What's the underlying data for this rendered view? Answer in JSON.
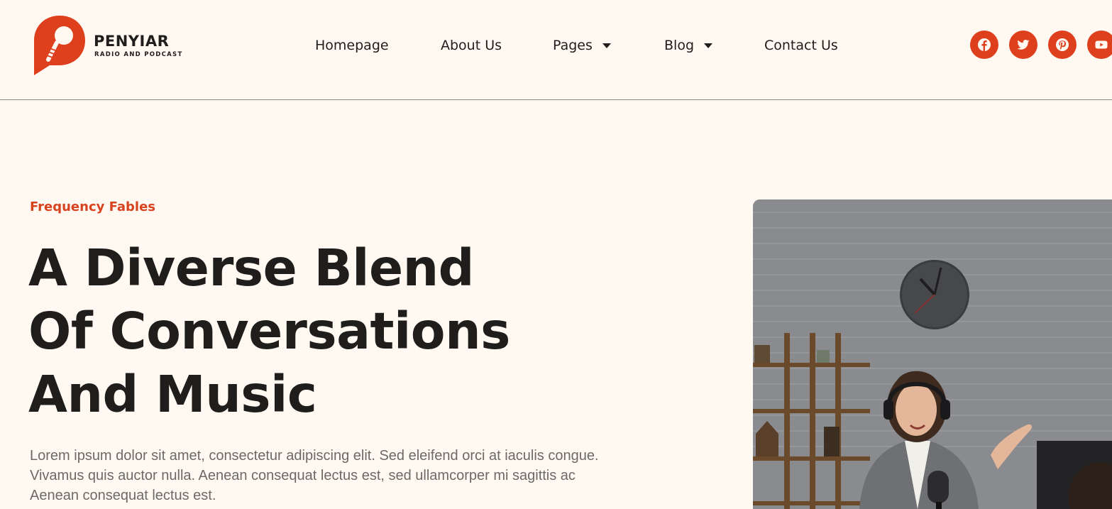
{
  "brand": {
    "name": "PENYIAR",
    "tagline": "RADIO AND PODCAST",
    "accent_color": "#de3f1c"
  },
  "nav": {
    "items": [
      {
        "label": "Homepage",
        "has_dropdown": false
      },
      {
        "label": "About Us",
        "has_dropdown": false
      },
      {
        "label": "Pages",
        "has_dropdown": true
      },
      {
        "label": "Blog",
        "has_dropdown": true
      },
      {
        "label": "Contact Us",
        "has_dropdown": false
      }
    ]
  },
  "social": [
    {
      "icon": "facebook-icon"
    },
    {
      "icon": "twitter-icon"
    },
    {
      "icon": "pinterest-icon"
    },
    {
      "icon": "youtube-icon"
    }
  ],
  "hero": {
    "eyebrow": "Frequency Fables",
    "headline_lines": [
      "A Diverse Blend",
      "Of Conversations",
      "And Music"
    ],
    "body_lines": [
      "Lorem ipsum dolor sit amet, consectetur adipiscing elit. Sed eleifend orci at iaculis congue.",
      "Vivamus quis auctor nulla. Aenean consequat lectus est, sed ullamcorper mi sagittis ac",
      "Aenean consequat lectus est."
    ],
    "image": "podcast-host-photo"
  }
}
